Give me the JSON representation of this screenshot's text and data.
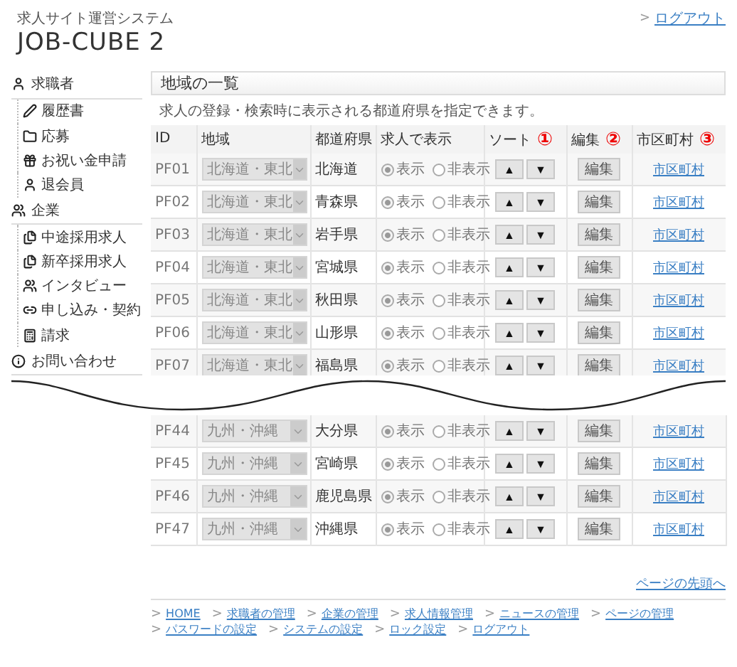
{
  "header": {
    "subtitle": "求人サイト運営システム",
    "title": "JOB-CUBE 2",
    "logout_mark": ">",
    "logout": "ログアウト"
  },
  "sidebar": [
    {
      "label": "求職者",
      "children": [
        {
          "label": "履歴書"
        },
        {
          "label": "応募"
        },
        {
          "label": "お祝い金申請"
        },
        {
          "label": "退会員"
        }
      ]
    },
    {
      "label": "企業",
      "children": [
        {
          "label": "中途採用求人"
        },
        {
          "label": "新卒採用求人"
        },
        {
          "label": "インタビュー"
        },
        {
          "label": "申し込み・契約"
        },
        {
          "label": "請求"
        }
      ]
    },
    {
      "label": "お問い合わせ"
    }
  ],
  "panel": {
    "title": "地域の一覧",
    "description": "求人の登録・検索時に表示される都道府県を指定できます。"
  },
  "columns": [
    {
      "label": "ID"
    },
    {
      "label": "地域"
    },
    {
      "label": "都道府県"
    },
    {
      "label": "求人で表示"
    },
    {
      "label": "ソート",
      "marker": "①"
    },
    {
      "label": "編集",
      "marker": "②"
    },
    {
      "label": "市区町村",
      "marker": "③"
    }
  ],
  "rows_top": [
    {
      "id": "PF01",
      "region": "北海道・東北",
      "prefecture": "北海道",
      "show": "表示",
      "hide": "非表示",
      "shown": true,
      "up": "▲",
      "down": "▼",
      "edit": "編集",
      "link": "市区町村"
    },
    {
      "id": "PF02",
      "region": "北海道・東北",
      "prefecture": "青森県",
      "show": "表示",
      "hide": "非表示",
      "shown": true,
      "up": "▲",
      "down": "▼",
      "edit": "編集",
      "link": "市区町村"
    },
    {
      "id": "PF03",
      "region": "北海道・東北",
      "prefecture": "岩手県",
      "show": "表示",
      "hide": "非表示",
      "shown": true,
      "up": "▲",
      "down": "▼",
      "edit": "編集",
      "link": "市区町村"
    },
    {
      "id": "PF04",
      "region": "北海道・東北",
      "prefecture": "宮城県",
      "show": "表示",
      "hide": "非表示",
      "shown": true,
      "up": "▲",
      "down": "▼",
      "edit": "編集",
      "link": "市区町村"
    },
    {
      "id": "PF05",
      "region": "北海道・東北",
      "prefecture": "秋田県",
      "show": "表示",
      "hide": "非表示",
      "shown": true,
      "up": "▲",
      "down": "▼",
      "edit": "編集",
      "link": "市区町村"
    },
    {
      "id": "PF06",
      "region": "北海道・東北",
      "prefecture": "山形県",
      "show": "表示",
      "hide": "非表示",
      "shown": true,
      "up": "▲",
      "down": "▼",
      "edit": "編集",
      "link": "市区町村"
    },
    {
      "id": "PF07",
      "region": "北海道・東北",
      "prefecture": "福島県",
      "show": "表示",
      "hide": "非表示",
      "shown": true,
      "up": "▲",
      "down": "▼",
      "edit": "編集",
      "link": "市区町村"
    }
  ],
  "rows_bottom": [
    {
      "id": "PF44",
      "region": "九州・沖縄",
      "prefecture": "大分県",
      "show": "表示",
      "hide": "非表示",
      "shown": true,
      "up": "▲",
      "down": "▼",
      "edit": "編集",
      "link": "市区町村"
    },
    {
      "id": "PF45",
      "region": "九州・沖縄",
      "prefecture": "宮崎県",
      "show": "表示",
      "hide": "非表示",
      "shown": true,
      "up": "▲",
      "down": "▼",
      "edit": "編集",
      "link": "市区町村"
    },
    {
      "id": "PF46",
      "region": "九州・沖縄",
      "prefecture": "鹿児島県",
      "show": "表示",
      "hide": "非表示",
      "shown": true,
      "up": "▲",
      "down": "▼",
      "edit": "編集",
      "link": "市区町村"
    },
    {
      "id": "PF47",
      "region": "九州・沖縄",
      "prefecture": "沖縄県",
      "show": "表示",
      "hide": "非表示",
      "shown": true,
      "up": "▲",
      "down": "▼",
      "edit": "編集",
      "link": "市区町村"
    }
  ],
  "page_top": "ページの先頭へ",
  "footer_mark": ">",
  "footer_links": [
    {
      "label": "HOME"
    },
    {
      "label": "求職者の管理"
    },
    {
      "label": "企業の管理"
    },
    {
      "label": "求人情報管理"
    },
    {
      "label": "ニュースの管理"
    },
    {
      "label": "ページの管理"
    },
    {
      "label": "パスワードの設定"
    },
    {
      "label": "システムの設定"
    },
    {
      "label": "ロック設定"
    },
    {
      "label": "ログアウト"
    }
  ]
}
